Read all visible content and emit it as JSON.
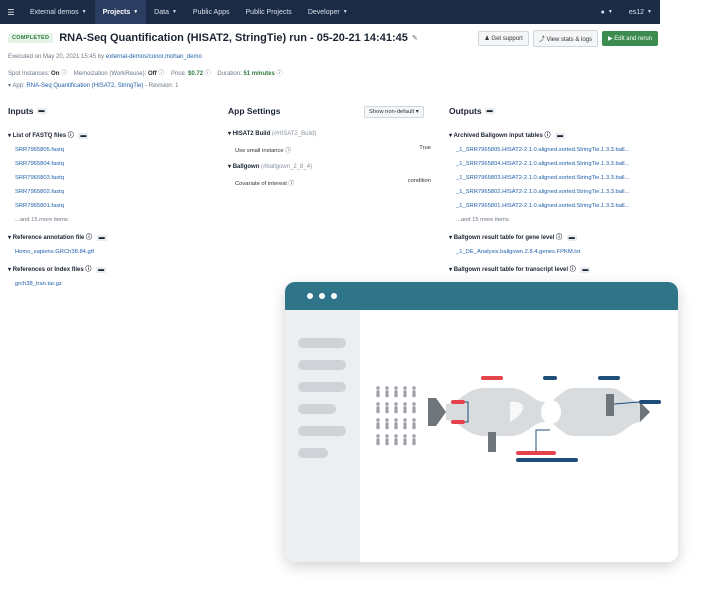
{
  "topnav": {
    "menu_icon": "☰",
    "items": [
      "External demos",
      "Projects",
      "Data",
      "Public Apps",
      "Public Projects",
      "Developer"
    ],
    "user": "es12"
  },
  "header": {
    "status": "COMPLETED",
    "title": "RNA-Seq Quantification (HISAT2, StringTie) run - 05-20-21 14:41:45",
    "buttons": {
      "support": "Get support",
      "stats": "View stats & logs",
      "edit": "Edit and rerun"
    }
  },
  "meta": {
    "executed_prefix": "Executed on May 20, 2021 15:45 by ",
    "executed_by": "external-demos/conor.mohan_demo",
    "spot_label": "Spot Instances:",
    "spot_value": "On",
    "memo_label": "Memoization (WorkReuse):",
    "memo_value": "Off",
    "price_label": "Price:",
    "price_value": "$0.72",
    "duration_label": "Duration:",
    "duration_value": "51 minutes",
    "app_label": "App:",
    "app_link": "RNA-Seq Quantification (HISAT2, StringTie)",
    "revision": "- Revision: 1"
  },
  "inputs": {
    "title": "Inputs",
    "fastq_label": "List of FASTQ files",
    "fastq_files": [
      "SRR7965805.fastq",
      "SRR7965804.fastq",
      "SRR7965803.fastq",
      "SRR7965802.fastq",
      "SRR7965801.fastq"
    ],
    "fastq_more": "...and 15 more items",
    "annotation_label": "Reference annotation file",
    "annotation_file": "Homo_sapiens.GRCh38.84.gtf",
    "index_label": "References or Index files",
    "index_file": "grch38_tran.tar.gz"
  },
  "settings": {
    "title": "App Settings",
    "dropdown": "Show non-default",
    "hisat_label": "HISAT2 Build",
    "hisat_id": "(#HISAT2_Build)",
    "small_instance_label": "Use small instance",
    "small_instance_value": "True",
    "ballgown_label": "Ballgown",
    "ballgown_id": "(#ballgown_2_8_4)",
    "covariate_label": "Covariate of interest",
    "covariate_value": "condition"
  },
  "outputs": {
    "title": "Outputs",
    "archived_label": "Archived Ballgown input tables",
    "archived_files": [
      "_1_SRR7965805.HISAT2-2.1.0.aligned.sorted.StringTie.1.3.3.ball...",
      "_1_SRR7965804.HISAT2-2.1.0.aligned.sorted.StringTie.1.3.3.ball...",
      "_1_SRR7965803.HISAT2-2.1.0.aligned.sorted.StringTie.1.3.3.ball...",
      "_1_SRR7965802.HISAT2-2.1.0.aligned.sorted.StringTie.1.3.3.ball...",
      "_1_SRR7965801.HISAT2-2.1.0.aligned.sorted.StringTie.1.3.3.ball..."
    ],
    "archived_more": "...and 15 more items",
    "gene_label": "Ballgown result table for gene level",
    "gene_file": "_1_DE_Analysis.ballgown.2.8.4.genes.FPKM.txt",
    "transcript_label": "Ballgown result table for transcript level"
  },
  "colors": {
    "nav_bg": "#1b2b46",
    "accent_green": "#3d8c4f",
    "window_bar": "#2f7488",
    "flow_red": "#e5424d",
    "flow_navy": "#1f4d7a"
  }
}
